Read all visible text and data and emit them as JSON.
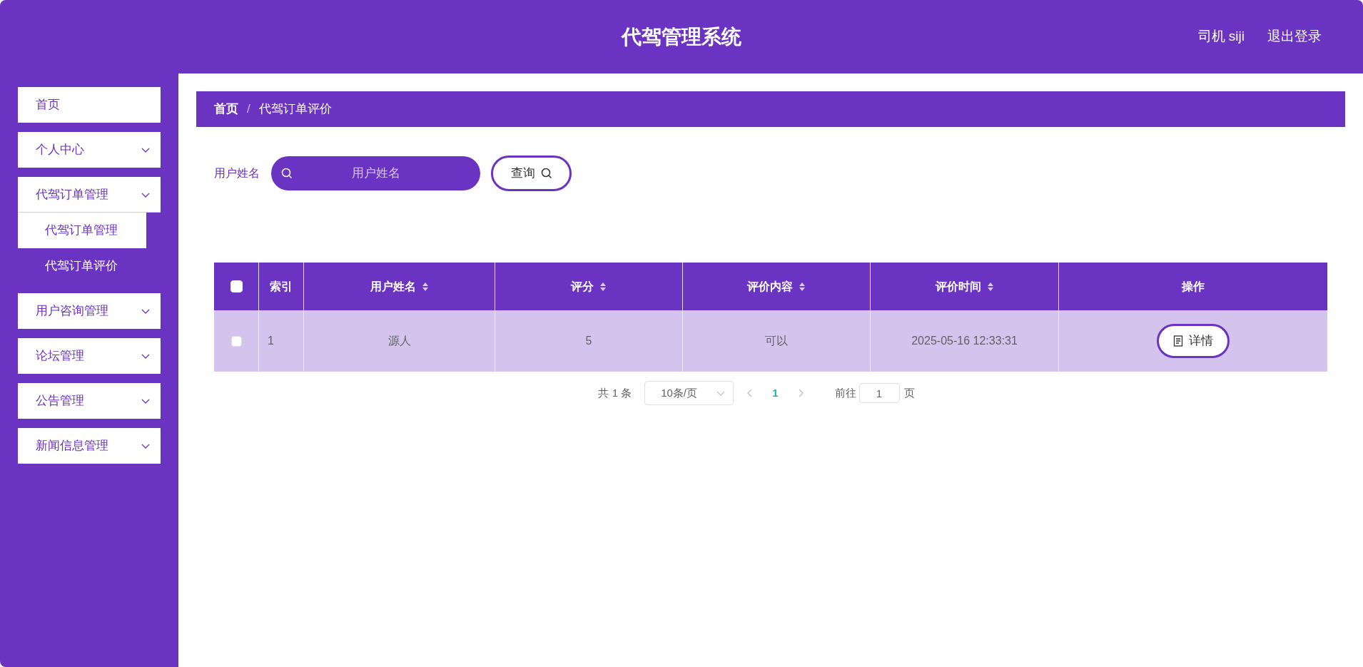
{
  "header": {
    "title": "代驾管理系统",
    "user": "司机 siji",
    "logout": "退出登录"
  },
  "sidebar": {
    "items": [
      {
        "label": "首页",
        "expanded": false
      },
      {
        "label": "个人中心",
        "expanded": false,
        "has_children": true
      },
      {
        "label": "代驾订单管理",
        "expanded": true,
        "has_children": true,
        "children": [
          {
            "label": "代驾订单管理",
            "selected": false
          },
          {
            "label": "代驾订单评价",
            "selected": true
          }
        ]
      },
      {
        "label": "用户咨询管理",
        "expanded": false,
        "has_children": true
      },
      {
        "label": "论坛管理",
        "expanded": false,
        "has_children": true
      },
      {
        "label": "公告管理",
        "expanded": false,
        "has_children": true
      },
      {
        "label": "新闻信息管理",
        "expanded": false,
        "has_children": true
      }
    ]
  },
  "breadcrumb": [
    "首页",
    "/",
    "代驾订单评价"
  ],
  "search": {
    "label": "用户姓名",
    "placeholder": "用户姓名",
    "button": "查询"
  },
  "table": {
    "all_checked": false,
    "columns": [
      {
        "label": "索引",
        "sortable": false
      },
      {
        "label": "用户姓名",
        "sortable": true
      },
      {
        "label": "评分",
        "sortable": true
      },
      {
        "label": "评价内容",
        "sortable": true
      },
      {
        "label": "评价时间",
        "sortable": true
      },
      {
        "label": "操作",
        "sortable": false
      }
    ],
    "rows": [
      {
        "checked": false,
        "cells": [
          "1",
          "源人",
          "5",
          "可以",
          "2025-05-16 12:33:31"
        ],
        "action": "详情"
      }
    ]
  },
  "pagination": {
    "total": "共 1 条",
    "page_size": "10条/页",
    "pages": [
      {
        "label": "1",
        "selected": true
      }
    ],
    "goto_label": "前往",
    "goto_value": "1",
    "goto_suffix": "页"
  }
}
